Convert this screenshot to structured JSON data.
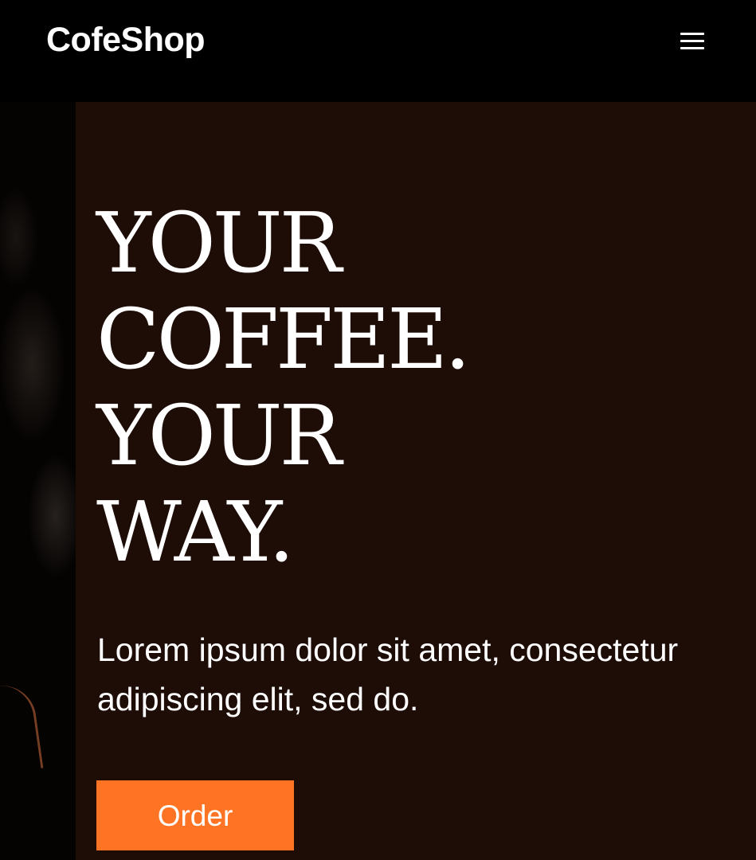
{
  "header": {
    "brand": "CofeShop",
    "menu_icon": "hamburger-menu-icon"
  },
  "hero": {
    "headline_lines": [
      "YOUR",
      "COFFEE.",
      "YOUR",
      "WAY."
    ],
    "subtitle": "Lorem ipsum dolor sit amet, consectetur adipiscing elit, sed do.",
    "cta_label": "Order"
  },
  "colors": {
    "page_background": "#000000",
    "panel_background": "#1e0d07",
    "accent": "#ff7424",
    "text": "#ffffff"
  }
}
